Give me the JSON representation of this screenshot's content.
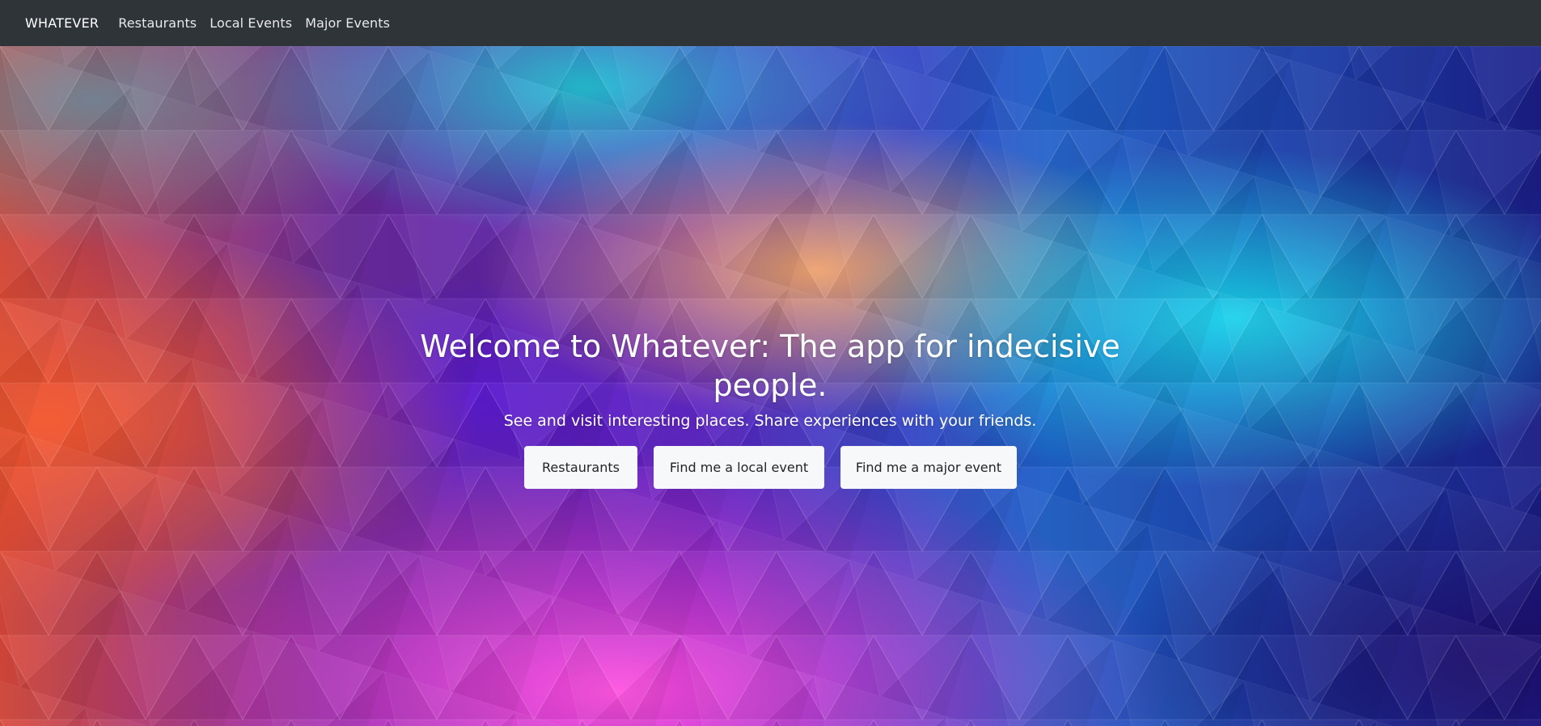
{
  "navbar": {
    "brand": "WHATEVER",
    "links": [
      {
        "label": "Restaurants"
      },
      {
        "label": "Local Events"
      },
      {
        "label": "Major Events"
      }
    ],
    "background_color": "#2f3438"
  },
  "hero": {
    "headline": "Welcome to Whatever: The app for indecisive people.",
    "subheadline": "See and visit interesting places. Share experiences with your friends.",
    "buttons": [
      {
        "label": "Restaurants"
      },
      {
        "label": "Find me a local event"
      },
      {
        "label": "Find me a major event"
      }
    ],
    "background": "low-poly-gradient-triangles",
    "palette": [
      "#e5502c",
      "#6a20c8",
      "#f23ec9",
      "#1fbfdc",
      "#f0a46a",
      "#1a2aa0"
    ]
  }
}
